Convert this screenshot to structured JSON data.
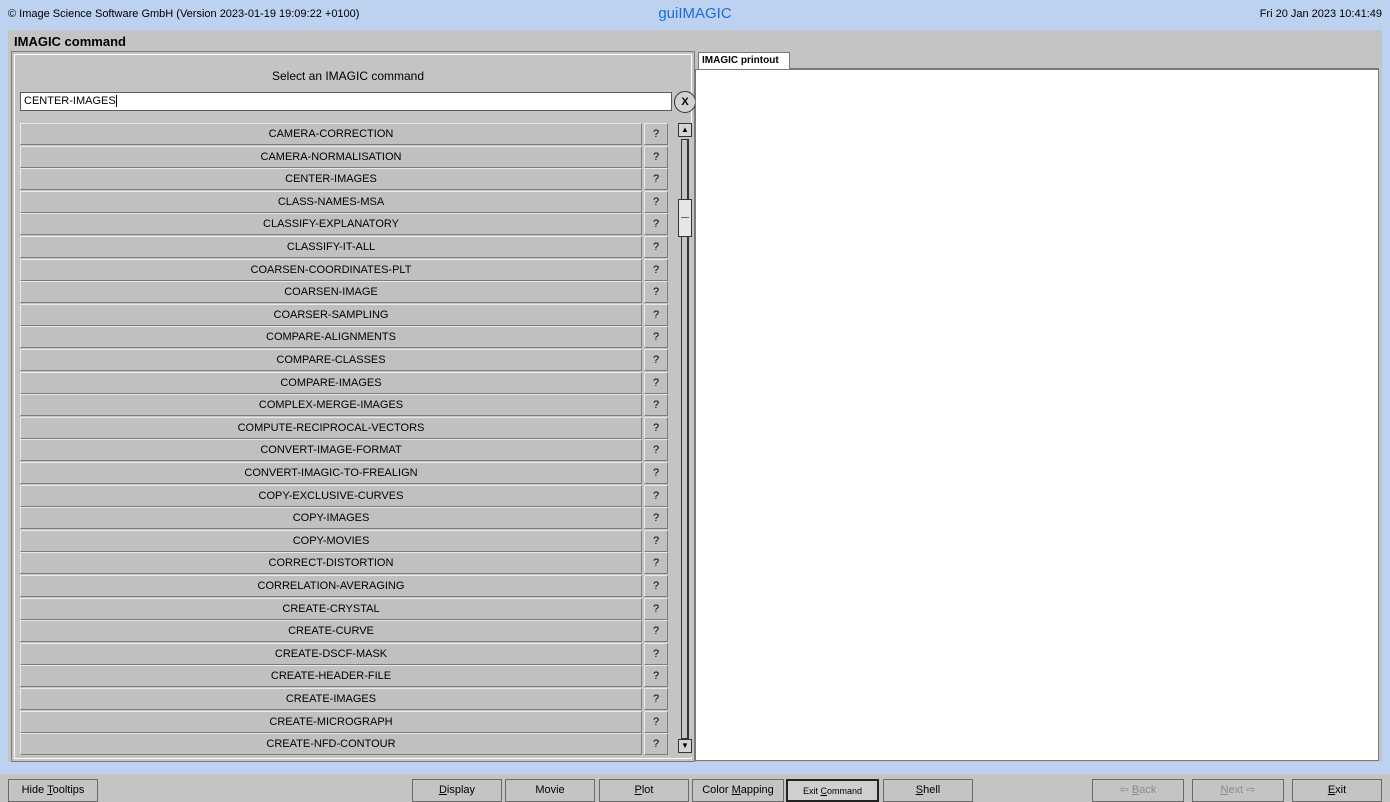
{
  "header": {
    "copyright": "© Image Science Software GmbH (Version 2023-01-19 19:09:22 +0100)",
    "app_title": "guiIMAGIC",
    "datetime": "Fri 20 Jan 2023 10:41:49"
  },
  "window": {
    "title": "IMAGIC command"
  },
  "command_panel": {
    "heading": "Select an IMAGIC command",
    "search_value": "CENTER-IMAGES",
    "clear_label": "X",
    "help_label": "?",
    "scroll_up": "▲",
    "scroll_down": "▼",
    "commands": [
      "CAMERA-CORRECTION",
      "CAMERA-NORMALISATION",
      "CENTER-IMAGES",
      "CLASS-NAMES-MSA",
      "CLASSIFY-EXPLANATORY",
      "CLASSIFY-IT-ALL",
      "COARSEN-COORDINATES-PLT",
      "COARSEN-IMAGE",
      "COARSER-SAMPLING",
      "COMPARE-ALIGNMENTS",
      "COMPARE-CLASSES",
      "COMPARE-IMAGES",
      "COMPLEX-MERGE-IMAGES",
      "COMPUTE-RECIPROCAL-VECTORS",
      "CONVERT-IMAGE-FORMAT",
      "CONVERT-IMAGIC-TO-FREALIGN",
      "COPY-EXCLUSIVE-CURVES",
      "COPY-IMAGES",
      "COPY-MOVIES",
      "CORRECT-DISTORTION",
      "CORRELATION-AVERAGING",
      "CREATE-CRYSTAL",
      "CREATE-CURVE",
      "CREATE-DSCF-MASK",
      "CREATE-HEADER-FILE",
      "CREATE-IMAGES",
      "CREATE-MICROGRAPH",
      "CREATE-NFD-CONTOUR"
    ]
  },
  "printout": {
    "tab_label": "IMAGIC printout"
  },
  "bottom_buttons": {
    "hide_tooltips": {
      "label": "Hide Tooltips",
      "mnemonic": "T"
    },
    "display": {
      "label": "Display",
      "mnemonic": "D"
    },
    "movie": {
      "label": "Movie",
      "mnemonic": ""
    },
    "plot": {
      "label": "Plot",
      "mnemonic": "P"
    },
    "color_mapping": {
      "label": "Color Mapping",
      "mnemonic": "M"
    },
    "exit_command": {
      "label": "Exit Command",
      "mnemonic": "C"
    },
    "shell": {
      "label": "Shell",
      "mnemonic": "S"
    },
    "back": {
      "label": "⇦ Back",
      "mnemonic": "B"
    },
    "next": {
      "label": "Next ⇨",
      "mnemonic": "N"
    },
    "exit": {
      "label": "Exit",
      "mnemonic": "E"
    }
  },
  "colors": {
    "background": "#bcd2f0",
    "app_title": "#1d6cd8",
    "panel": "#c4c4c4",
    "row": "#c0c0c0",
    "disabled_text": "#8c8c8c"
  }
}
